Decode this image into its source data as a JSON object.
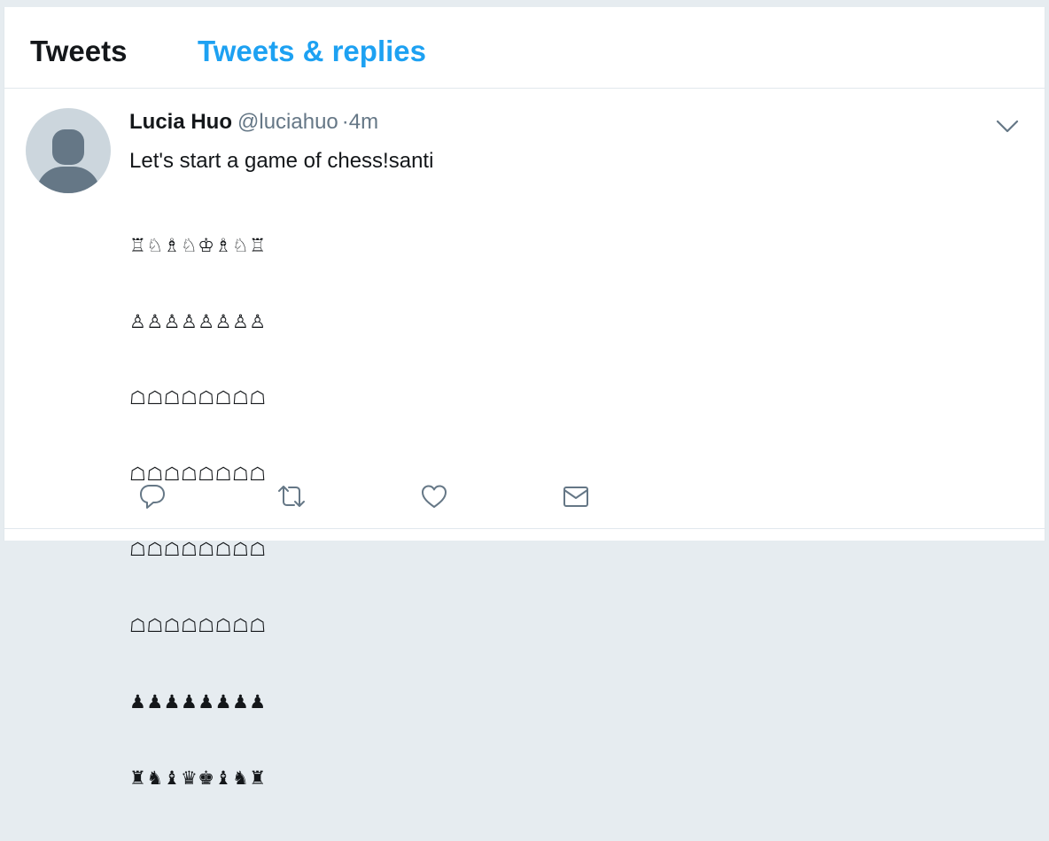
{
  "tabs": {
    "tweets": "Tweets",
    "tweets_and_replies": "Tweets & replies"
  },
  "tweet": {
    "author_name": "Lucia Huo",
    "handle": "@luciahuo",
    "separator": "·",
    "time": "4m",
    "text": "Let's start a game of chess!santi",
    "board_rows": [
      "♖♘♗♘♔♗♘♖",
      "♙♙♙♙♙♙♙♙",
      "☖☖☖☖☖☖☖☖",
      "☖☖☖☖☖☖☖☖",
      "☖☖☖☖☖☖☖☖",
      "☖☖☖☖☖☖☖☖",
      "♟♟♟♟♟♟♟♟",
      "♜♞♝♛♚♝♞♜"
    ]
  },
  "icons": {
    "reply": "reply-icon",
    "retweet": "retweet-icon",
    "like": "heart-icon",
    "dm": "envelope-icon",
    "menu": "chevron-down-icon"
  },
  "colors": {
    "accent": "#1da1f2",
    "text": "#14171a",
    "secondary": "#657786",
    "border": "#e1e8ed",
    "background": "#e6ecf0"
  }
}
